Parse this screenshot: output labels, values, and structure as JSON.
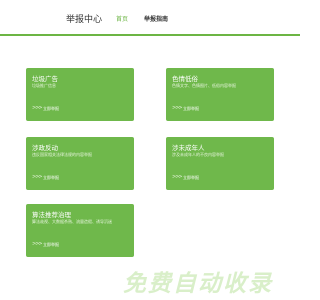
{
  "header": {
    "brand": "举报中心",
    "nav": [
      {
        "label": "首页",
        "active": true
      },
      {
        "label": "举报指南",
        "active": false
      }
    ],
    "accent_color": "#6cb544"
  },
  "cards": [
    {
      "title": "垃圾广告",
      "desc": "垃圾推广信息",
      "link": "立即举报"
    },
    {
      "title": "色情低俗",
      "desc": "色情文字、色情图片、低俗内容举报",
      "link": "立即举报"
    },
    {
      "title": "涉政反动",
      "desc": "违反国家相关法律法规的内容举报",
      "link": "立即举报"
    },
    {
      "title": "涉未成年人",
      "desc": "涉及未成年人的不良内容举报",
      "link": "立即举报"
    },
    {
      "title": "算法推荐治理",
      "desc": "算法歧视、大数据杀熟、流量造假、诱导沉迷",
      "link": "立即举报"
    }
  ],
  "card_color": "#6fb84b",
  "watermark": "免费自动收录"
}
